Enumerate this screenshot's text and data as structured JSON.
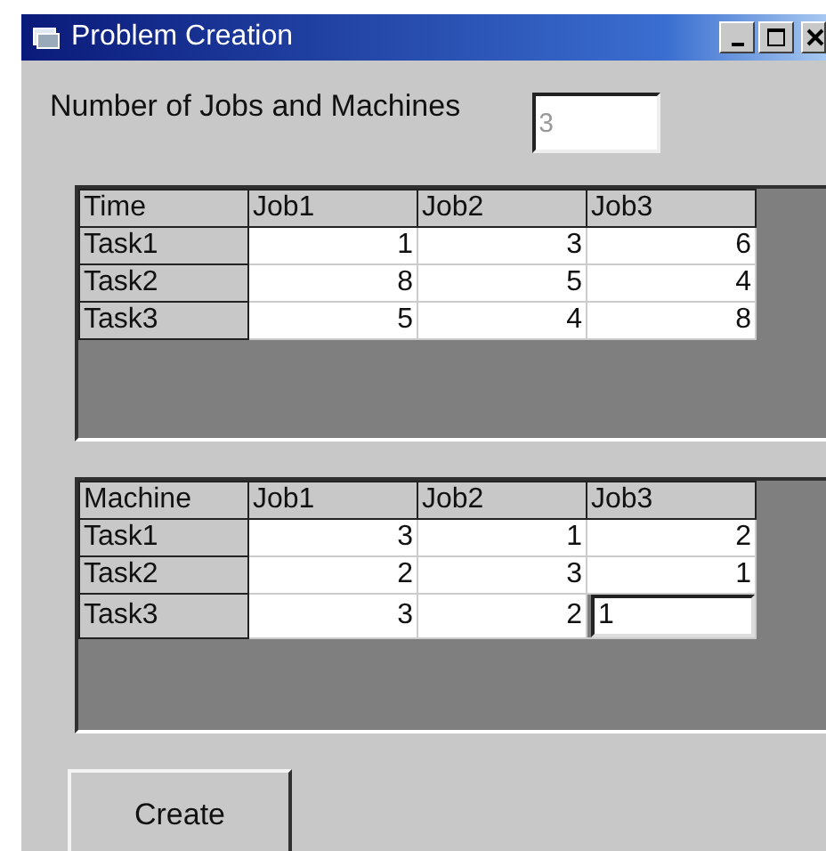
{
  "window": {
    "title": "Problem Creation"
  },
  "count_field": {
    "label": "Number of Jobs and Machines",
    "value": "3",
    "disabled": true
  },
  "grids": [
    {
      "corner": "Time",
      "columns": [
        "Job1",
        "Job2",
        "Job3"
      ],
      "rows": [
        {
          "label": "Task1",
          "cells": [
            {
              "value": "1",
              "editing": false
            },
            {
              "value": "3",
              "editing": false
            },
            {
              "value": "6",
              "editing": false
            }
          ]
        },
        {
          "label": "Task2",
          "cells": [
            {
              "value": "8",
              "editing": false
            },
            {
              "value": "5",
              "editing": false
            },
            {
              "value": "4",
              "editing": false
            }
          ]
        },
        {
          "label": "Task3",
          "cells": [
            {
              "value": "5",
              "editing": false
            },
            {
              "value": "4",
              "editing": false
            },
            {
              "value": "8",
              "editing": false
            }
          ]
        }
      ]
    },
    {
      "corner": "Machine",
      "columns": [
        "Job1",
        "Job2",
        "Job3"
      ],
      "rows": [
        {
          "label": "Task1",
          "cells": [
            {
              "value": "3",
              "editing": false
            },
            {
              "value": "1",
              "editing": false
            },
            {
              "value": "2",
              "editing": false
            }
          ]
        },
        {
          "label": "Task2",
          "cells": [
            {
              "value": "2",
              "editing": false
            },
            {
              "value": "3",
              "editing": false
            },
            {
              "value": "1",
              "editing": false
            }
          ]
        },
        {
          "label": "Task3",
          "cells": [
            {
              "value": "3",
              "editing": false
            },
            {
              "value": "2",
              "editing": false
            },
            {
              "value": "1",
              "editing": true
            }
          ]
        }
      ]
    }
  ],
  "buttons": [
    "Create"
  ]
}
